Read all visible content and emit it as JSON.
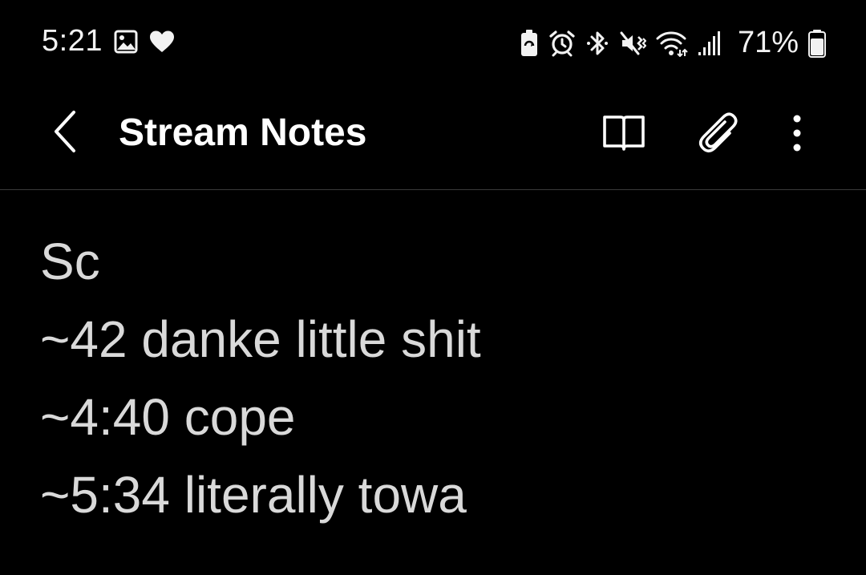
{
  "status_bar": {
    "time": "5:21",
    "left_icons": [
      "gallery-icon",
      "heart-icon"
    ],
    "right_icons": [
      "battery-saver-icon",
      "alarm-icon",
      "bluetooth-icon",
      "mute-vibrate-icon",
      "wifi-icon",
      "signal-icon",
      "battery-icon"
    ],
    "battery_percent": "71%"
  },
  "app_bar": {
    "title": "Stream Notes",
    "actions": [
      "reading-mode-icon",
      "attach-icon",
      "more-options-icon"
    ]
  },
  "note": {
    "lines": [
      "Sc",
      "~42 danke little shit",
      "~4:40 cope",
      "~5:34 literally towa"
    ]
  },
  "colors": {
    "background": "#000000",
    "title_text": "#ffffff",
    "body_text": "#d9d9d9",
    "divider": "#3a3a3a"
  }
}
